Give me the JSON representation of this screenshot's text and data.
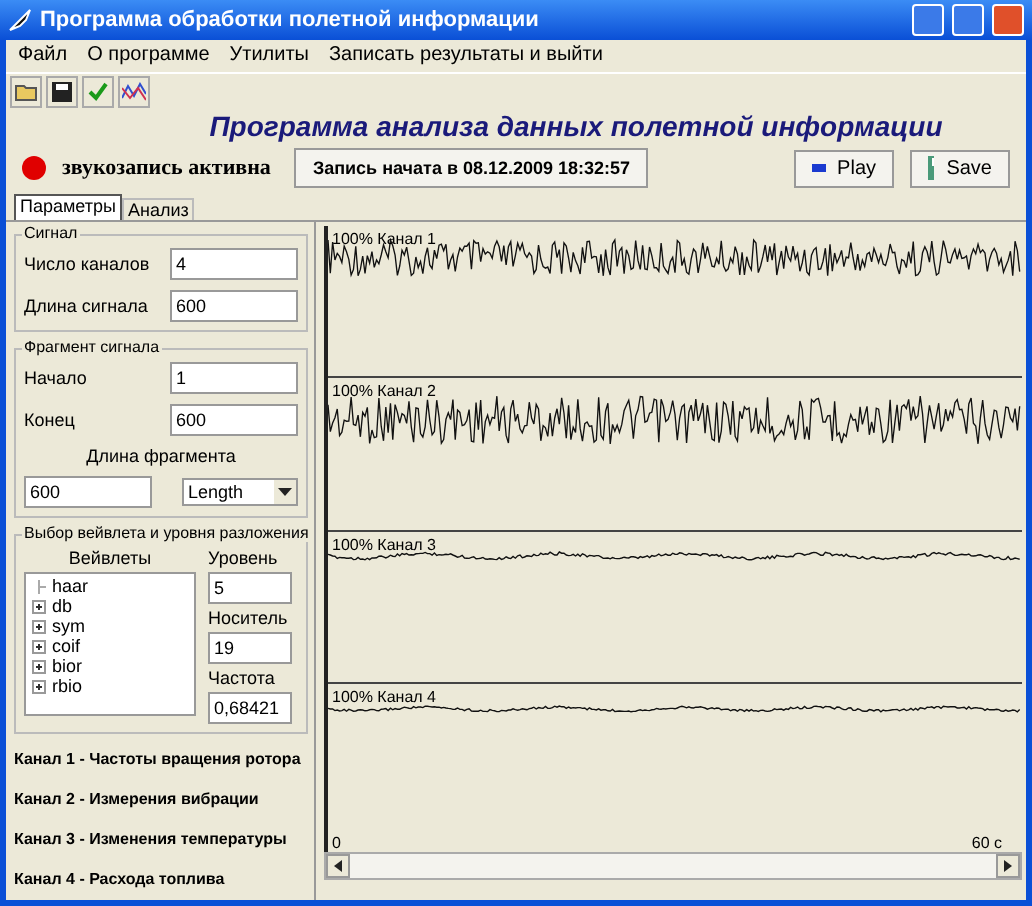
{
  "window": {
    "title": "Программа обработки полетной информации"
  },
  "menu": [
    "Файл",
    "О программе",
    "Утилиты",
    "Записать результаты и выйти"
  ],
  "heading": "Программа  анализа  данных полетной информации",
  "recording": {
    "active": true,
    "label": "звукозапись активна",
    "started": "Запись начата в 08.12.2009 18:32:57"
  },
  "buttons": [
    {
      "label": "Play",
      "kind": "play"
    },
    {
      "label": "Save",
      "kind": "save"
    }
  ],
  "tabs": [
    {
      "label": "Параметры",
      "selected": true
    },
    {
      "label": "Анализ",
      "selected": false
    }
  ],
  "signal": {
    "title": "Сигнал",
    "fields": [
      {
        "label": "Число каналов",
        "value": "4"
      },
      {
        "label": "Длина сигнала",
        "value": "600"
      }
    ]
  },
  "fragment": {
    "title": "Фрагмент сигнала",
    "fields": [
      {
        "label": "Начало",
        "value": "1"
      },
      {
        "label": "Конец",
        "value": "600"
      }
    ],
    "length_label": "Длина фрагмента",
    "length_value": "600",
    "length_mode": "Length"
  },
  "wavelet": {
    "title": "Выбор вейвлета и уровня разложения",
    "list_header": "Вейвлеты",
    "families": [
      {
        "name": "haar",
        "expandable": false
      },
      {
        "name": "db",
        "expandable": true
      },
      {
        "name": "sym",
        "expandable": true
      },
      {
        "name": "coif",
        "expandable": true
      },
      {
        "name": "bior",
        "expandable": true
      },
      {
        "name": "rbio",
        "expandable": true
      }
    ],
    "fields": [
      {
        "label": "Уровень",
        "value": "5"
      },
      {
        "label": "Носитель",
        "value": "19"
      },
      {
        "label": "Частота",
        "value": "0,68421"
      }
    ]
  },
  "legend": [
    "Канал 1 - Частоты вращения ротора",
    "Канал 2 - Измерения вибрации",
    "Канал 3 - Изменения температуры",
    "Канал 4 - Расхода топлива"
  ],
  "plot": {
    "channels": [
      "100% Канал 1",
      "100% Канал 2",
      "100% Канал 3",
      "100% Канал 4"
    ],
    "x_start": "0",
    "x_end": "60 с"
  }
}
